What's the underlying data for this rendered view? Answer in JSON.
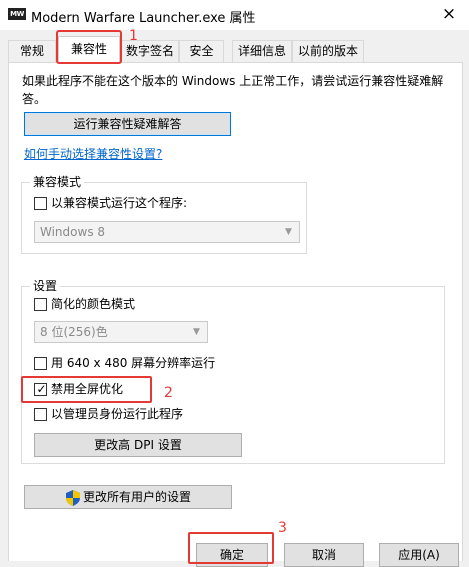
{
  "window": {
    "app_icon_text": "MW",
    "title": "Modern Warfare Launcher.exe 属性",
    "close_glyph": "×"
  },
  "tabs": [
    {
      "label": "常规",
      "active": false
    },
    {
      "label": "兼容性",
      "active": true
    },
    {
      "label": "数字签名",
      "active": false
    },
    {
      "label": "安全",
      "active": false
    },
    {
      "label": "详细信息",
      "active": false
    },
    {
      "label": "以前的版本",
      "active": false
    }
  ],
  "intro_text": "如果此程序不能在这个版本的 Windows 上正常工作，请尝试运行兼容性疑难解答。",
  "troubleshooter_button": "运行兼容性疑难解答",
  "manual_link": "如何手动选择兼容性设置?",
  "compat_mode": {
    "group_label": "兼容模式",
    "checkbox_label": "以兼容模式运行这个程序:",
    "checked": false,
    "select_value": "Windows 8"
  },
  "settings": {
    "group_label": "设置",
    "reduced_color_label": "简化的颜色模式",
    "reduced_color_checked": false,
    "color_select_value": "8 位(256)色",
    "res_640_label": "用 640 x 480 屏幕分辨率运行",
    "res_640_checked": false,
    "disable_fullscreen_label": "禁用全屏优化",
    "disable_fullscreen_checked": true,
    "run_as_admin_label": "以管理员身份运行此程序",
    "run_as_admin_checked": false,
    "dpi_button": "更改高 DPI 设置"
  },
  "all_users_button": "更改所有用户的设置",
  "footer": {
    "ok": "确定",
    "cancel": "取消",
    "apply": "应用(A)"
  },
  "annotations": {
    "one": "1",
    "two": "2",
    "three": "3"
  },
  "colors": {
    "annotation_red": "#e53935",
    "link_blue": "#0066cc",
    "focus_blue": "#0078d7"
  },
  "icons": {
    "close": "close-icon",
    "shield": "uac-shield-icon",
    "dropdown": "chevron-down-icon",
    "app": "app-icon"
  }
}
